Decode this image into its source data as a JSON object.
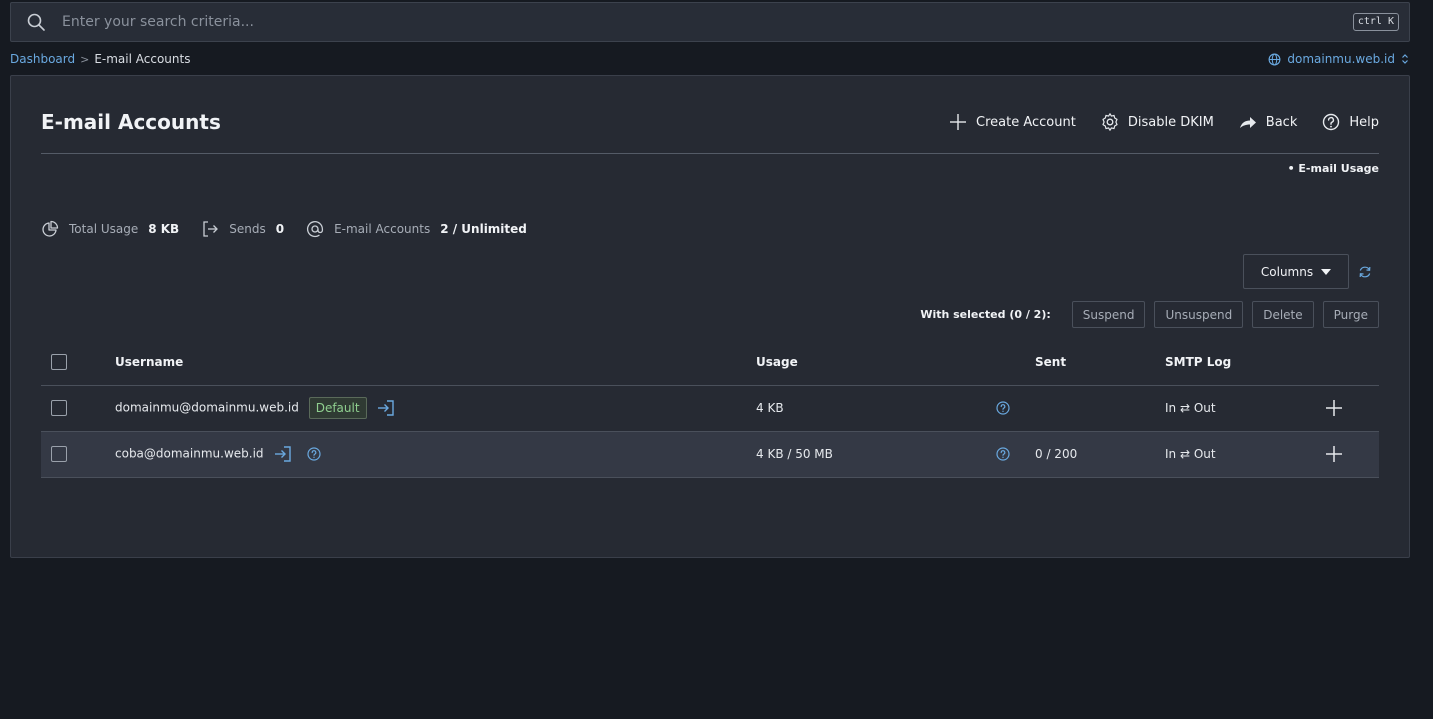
{
  "search": {
    "placeholder": "Enter your search criteria...",
    "shortcut": "ctrl K"
  },
  "breadcrumb": {
    "home": "Dashboard",
    "separator": ">",
    "current": "E-mail Accounts"
  },
  "domain_selector": {
    "value": "domainmu.web.id"
  },
  "page": {
    "title": "E-mail Accounts",
    "actions": {
      "create": "Create Account",
      "dkim": "Disable DKIM",
      "back": "Back",
      "help": "Help"
    },
    "usage_link": "• E-mail Usage"
  },
  "stats": {
    "total_usage_label": "Total Usage",
    "total_usage_value": "8 KB",
    "sends_label": "Sends",
    "sends_value": "0",
    "accounts_label": "E-mail Accounts",
    "accounts_value": "2 / Unlimited"
  },
  "toolbar": {
    "columns_label": "Columns"
  },
  "bulk": {
    "label": "With selected (0 / 2):",
    "suspend": "Suspend",
    "unsuspend": "Unsuspend",
    "delete": "Delete",
    "purge": "Purge"
  },
  "table": {
    "headers": {
      "username": "Username",
      "usage": "Usage",
      "sent": "Sent",
      "smtp": "SMTP Log"
    },
    "rows": [
      {
        "username": "domainmu@domainmu.web.id",
        "badge": "Default",
        "usage": "4 KB",
        "sent": "",
        "smtp": "In ⇄ Out"
      },
      {
        "username": "coba@domainmu.web.id",
        "badge": "",
        "usage": "4 KB / 50 MB",
        "sent": "0 / 200",
        "smtp": "In ⇄ Out"
      }
    ]
  },
  "colors": {
    "accent": "#6aa9e0",
    "background": "#161a21",
    "panel": "#262a33",
    "default_badge": "#8fcf8f"
  }
}
